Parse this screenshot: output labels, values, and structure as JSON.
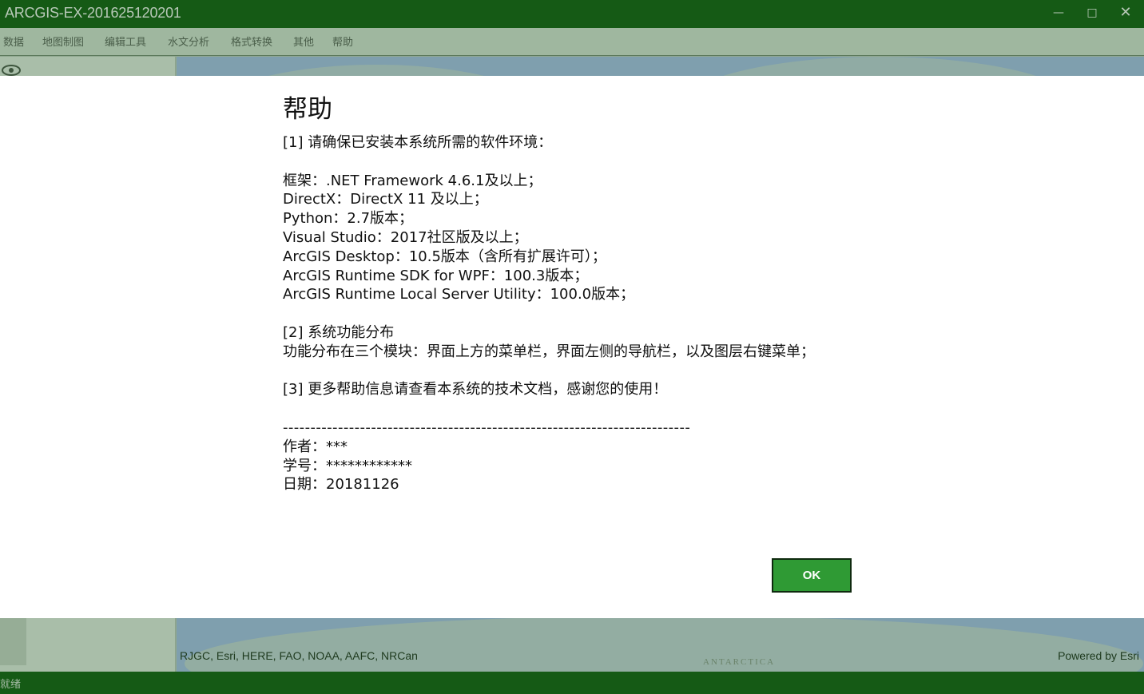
{
  "window": {
    "title": "ARCGIS-EX-201625120201"
  },
  "menubar": {
    "items": [
      "数据",
      "地图制图",
      "编辑工具",
      "水文分析",
      "格式转换",
      "其他",
      "帮助"
    ]
  },
  "map": {
    "attribution": "RJGC, Esri, HERE, FAO, NOAA, AAFC, NRCan",
    "powered_by": "Powered by Esri",
    "antarctica_label": "ANTARCTICA"
  },
  "statusbar": {
    "status": "就绪"
  },
  "dialog": {
    "title": "帮助",
    "lines": [
      "[1] 请确保已安装本系统所需的软件环境：",
      "",
      "框架：.NET Framework 4.6.1及以上；",
      "DirectX：DirectX 11 及以上；",
      "Python：2.7版本；",
      "Visual Studio：2017社区版及以上；",
      "ArcGIS Desktop：10.5版本（含所有扩展许可）；",
      "ArcGIS Runtime SDK for WPF：100.3版本；",
      "ArcGIS Runtime Local Server Utility：100.0版本；",
      "",
      "[2] 系统功能分布",
      "功能分布在三个模块：界面上方的菜单栏，界面左侧的导航栏，以及图层右键菜单；",
      "",
      "[3] 更多帮助信息请查看本系统的技术文档，感谢您的使用！",
      "",
      "--------------------------------------------------------------------------",
      "作者：***",
      "学号：************",
      "日期：20181126"
    ],
    "ok_label": "OK"
  }
}
